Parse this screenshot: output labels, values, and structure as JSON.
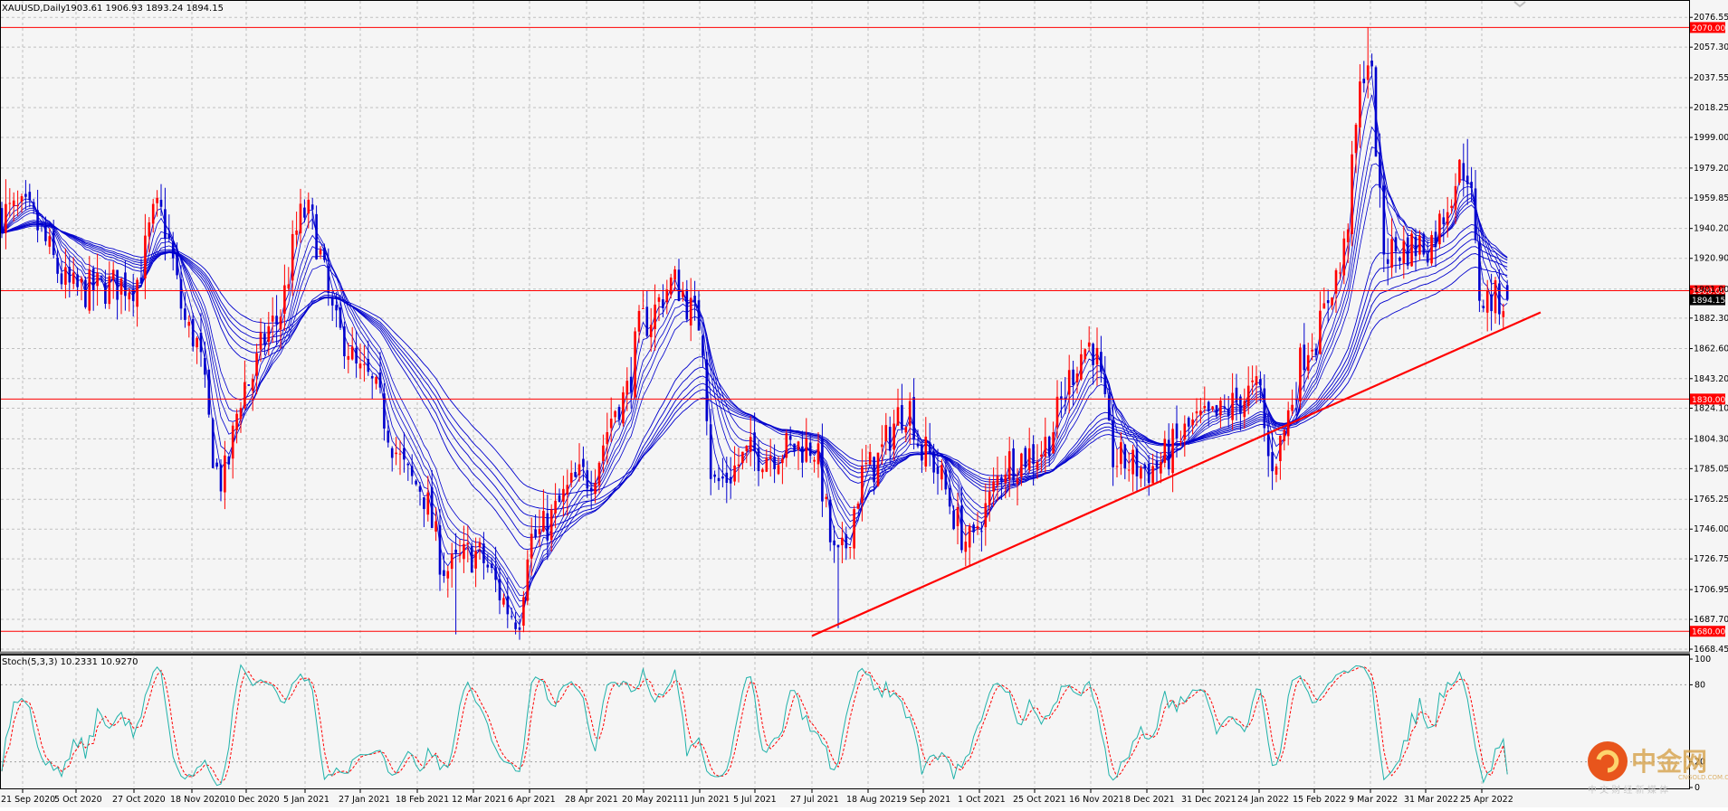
{
  "header": {
    "symbol_label": "XAUUSD,Daily",
    "ohlc_label": "1903.61 1906.93 1893.24 1894.15"
  },
  "indicator": {
    "label": "Stoch(5,3,3) 10.2331 10.9270",
    "levels": [
      "100",
      "80",
      "20",
      "0"
    ],
    "main_color": "#20b2aa",
    "signal_color": "#ff0000"
  },
  "colors": {
    "bull_candle": "#ff0000",
    "bear_candle": "#0000cd",
    "ma_ribbon": "#0000cd",
    "horizontal_level": "#ff0000",
    "trendline": "#ff0000",
    "grid": "#c0c0c0",
    "background": "#f5f5f5"
  },
  "watermark": {
    "brand_cn": "中金网",
    "domain": "CNGOLD.COM.CN",
    "slogan": "中 文 财 经 新 媒 体"
  },
  "chart_data": {
    "type": "candlestick",
    "title": "XAUUSD,Daily",
    "ylim": [
      1668.45,
      2092
    ],
    "price_axis_ticks": [
      "2076.55",
      "2057.30",
      "2037.55",
      "2018.25",
      "1999.00",
      "1979.20",
      "1959.85",
      "1940.20",
      "1920.90",
      "1901.00",
      "1882.30",
      "1862.60",
      "1843.20",
      "1824.10",
      "1804.30",
      "1785.05",
      "1765.25",
      "1746.00",
      "1726.75",
      "1706.95",
      "1687.70",
      "1668.45"
    ],
    "date_ticks": [
      "21 Sep 2020",
      "5 Oct 2020",
      "27 Oct 2020",
      "18 Nov 2020",
      "10 Dec 2020",
      "5 Jan 2021",
      "27 Jan 2021",
      "18 Feb 2021",
      "12 Mar 2021",
      "6 Apr 2021",
      "28 Apr 2021",
      "20 May 2021",
      "11 Jun 2021",
      "5 Jul 2021",
      "27 Jul 2021",
      "18 Aug 2021",
      "9 Sep 2021",
      "1 Oct 2021",
      "25 Oct 2021",
      "16 Nov 2021",
      "8 Dec 2021",
      "31 Dec 2021",
      "24 Jan 2022",
      "15 Feb 2022",
      "9 Mar 2022",
      "31 Mar 2022",
      "25 Apr 2022"
    ],
    "horizontal_levels": [
      {
        "price": 2070.0,
        "label": "2070.00"
      },
      {
        "price": 1900.0,
        "label": "1900.00"
      },
      {
        "price": 1830.0,
        "label": "1830.00"
      },
      {
        "price": 1680.0,
        "label": "1680.00"
      }
    ],
    "current_price": {
      "price": 1894.15,
      "label": "1894.15"
    },
    "trendline": {
      "from": {
        "date": "27 Jul 2021",
        "price": 1677
      },
      "to": {
        "date": "27 Apr 2022",
        "price": 1886
      }
    },
    "close_path": [
      [
        "21 Sep 2020",
        1950
      ],
      [
        "5 Oct 2020",
        1900
      ],
      [
        "27 Oct 2020",
        1905
      ],
      [
        "5 Nov 2020",
        1950
      ],
      [
        "18 Nov 2020",
        1872
      ],
      [
        "30 Nov 2020",
        1778
      ],
      [
        "10 Dec 2020",
        1840
      ],
      [
        "22 Dec 2020",
        1878
      ],
      [
        "5 Jan 2021",
        1950
      ],
      [
        "20 Jan 2021",
        1870
      ],
      [
        "27 Jan 2021",
        1845
      ],
      [
        "18 Feb 2021",
        1775
      ],
      [
        "2 Mar 2021",
        1720
      ],
      [
        "12 Mar 2021",
        1730
      ],
      [
        "1 Apr 2021",
        1690
      ],
      [
        "6 Apr 2021",
        1740
      ],
      [
        "28 Apr 2021",
        1780
      ],
      [
        "12 May 2021",
        1830
      ],
      [
        "20 May 2021",
        1880
      ],
      [
        "1 Jun 2021",
        1905
      ],
      [
        "11 Jun 2021",
        1880
      ],
      [
        "17 Jun 2021",
        1775
      ],
      [
        "5 Jul 2021",
        1795
      ],
      [
        "27 Jul 2021",
        1800
      ],
      [
        "6 Aug 2021",
        1725
      ],
      [
        "18 Aug 2021",
        1785
      ],
      [
        "3 Sep 2021",
        1825
      ],
      [
        "9 Sep 2021",
        1795
      ],
      [
        "29 Sep 2021",
        1735
      ],
      [
        "1 Oct 2021",
        1755
      ],
      [
        "14 Oct 2021",
        1790
      ],
      [
        "25 Oct 2021",
        1795
      ],
      [
        "16 Nov 2021",
        1865
      ],
      [
        "26 Nov 2021",
        1790
      ],
      [
        "8 Dec 2021",
        1785
      ],
      [
        "31 Dec 2021",
        1815
      ],
      [
        "24 Jan 2022",
        1835
      ],
      [
        "28 Jan 2022",
        1790
      ],
      [
        "15 Feb 2022",
        1870
      ],
      [
        "24 Feb 2022",
        1910
      ],
      [
        "8 Mar 2022",
        2050
      ],
      [
        "15 Mar 2022",
        1925
      ],
      [
        "31 Mar 2022",
        1930
      ],
      [
        "18 Apr 2022",
        1980
      ],
      [
        "25 Apr 2022",
        1894.15
      ]
    ]
  }
}
